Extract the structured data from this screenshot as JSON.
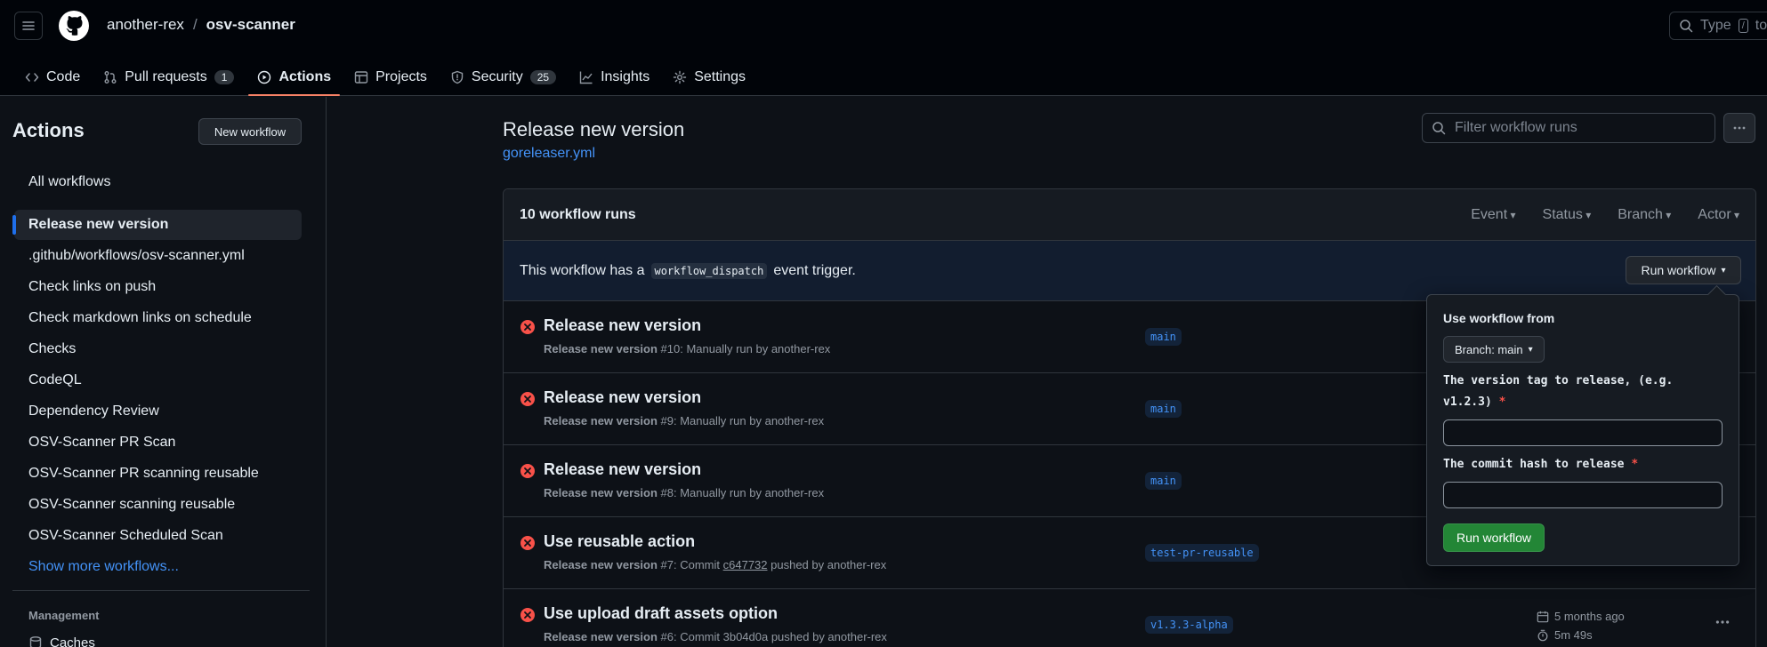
{
  "header": {
    "owner": "another-rex",
    "separator": "/",
    "repo": "osv-scanner",
    "search_placeholder": "Type",
    "search_key": "/",
    "search_after": "to"
  },
  "tabs": [
    {
      "label": "Code",
      "icon": "code-icon"
    },
    {
      "label": "Pull requests",
      "count": "1",
      "icon": "pull-request-icon"
    },
    {
      "label": "Actions",
      "icon": "play-icon",
      "active": true
    },
    {
      "label": "Projects",
      "icon": "table-icon"
    },
    {
      "label": "Security",
      "count": "25",
      "icon": "shield-icon"
    },
    {
      "label": "Insights",
      "icon": "graph-icon"
    },
    {
      "label": "Settings",
      "icon": "gear-icon"
    }
  ],
  "sidebar": {
    "title": "Actions",
    "new_workflow": "New workflow",
    "all_workflows": "All workflows",
    "items": [
      "Release new version",
      ".github/workflows/osv-scanner.yml",
      "Check links on push",
      "Check markdown links on schedule",
      "Checks",
      "CodeQL",
      "Dependency Review",
      "OSV-Scanner PR Scan",
      "OSV-Scanner PR scanning reusable",
      "OSV-Scanner scanning reusable",
      "OSV-Scanner Scheduled Scan"
    ],
    "show_more": "Show more workflows...",
    "management_heading": "Management",
    "caches": "Caches"
  },
  "main": {
    "title": "Release new version",
    "file": "goreleaser.yml",
    "filter_placeholder": "Filter workflow runs",
    "runs_count": "10 workflow runs",
    "filters": [
      "Event",
      "Status",
      "Branch",
      "Actor"
    ],
    "dispatch_prefix": "This workflow has a",
    "dispatch_code": "workflow_dispatch",
    "dispatch_suffix": "event trigger.",
    "run_workflow_button": "Run workflow"
  },
  "runs": [
    {
      "title": "Release new version",
      "workflow": "Release new version",
      "detail_a": "#10: Manually run by another-rex",
      "commit": "",
      "detail_b": "",
      "branch": "main"
    },
    {
      "title": "Release new version",
      "workflow": "Release new version",
      "detail_a": "#9: Manually run by another-rex",
      "commit": "",
      "detail_b": "",
      "branch": "main"
    },
    {
      "title": "Release new version",
      "workflow": "Release new version",
      "detail_a": "#8: Manually run by another-rex",
      "commit": "",
      "detail_b": "",
      "branch": "main"
    },
    {
      "title": "Use reusable action",
      "workflow": "Release new version",
      "detail_a": "#7: Commit",
      "commit": "c647732",
      "detail_b": "pushed by another-rex",
      "branch": "test-pr-reusable"
    },
    {
      "title": "Use upload draft assets option",
      "workflow": "Release new version",
      "detail_a": "#6: Commit 3b04d0a pushed by another-rex",
      "commit": "",
      "detail_b": "",
      "branch": "v1.3.3-alpha",
      "date": "5 months ago",
      "duration": "5m 49s"
    }
  ],
  "popover": {
    "heading": "Use workflow from",
    "branch_button": "Branch: main",
    "label_version_1": "The version tag to release, (e.g.",
    "label_version_2": "v1.2.3)",
    "label_commit": "The commit hash to release",
    "required_mark": "*",
    "submit": "Run workflow"
  },
  "colors": {
    "background": "#0d1117",
    "accent_link": "#4493f8",
    "active_tab_underline": "#f78166",
    "error": "#f85149",
    "run_button": "#238636"
  }
}
